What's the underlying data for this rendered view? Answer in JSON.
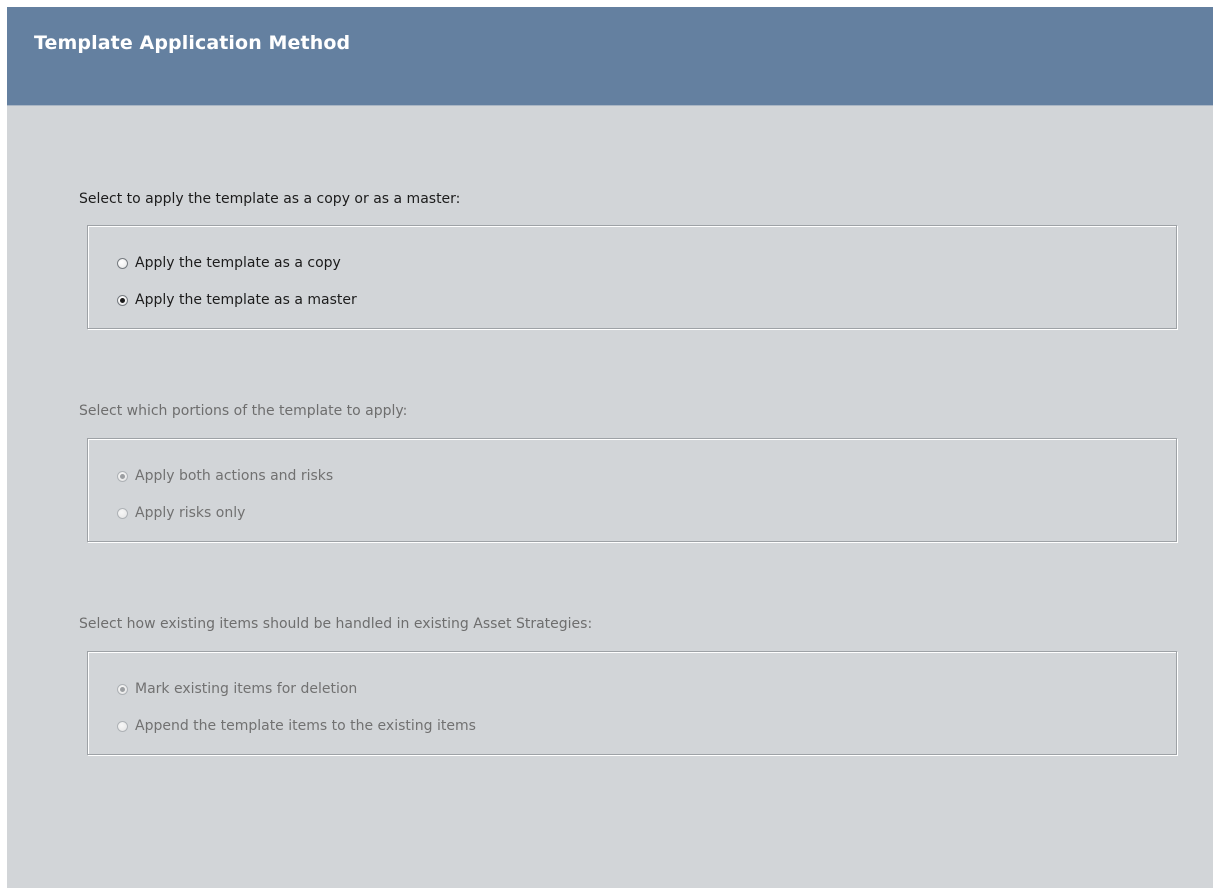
{
  "header": {
    "title": "Template Application Method"
  },
  "sections": [
    {
      "label": "Select to apply the template as a copy or as a master:",
      "enabled": true,
      "options": [
        {
          "label": "Apply the template as a copy",
          "selected": false
        },
        {
          "label": "Apply the template as a master",
          "selected": true
        }
      ]
    },
    {
      "label": "Select which portions of the template to apply:",
      "enabled": false,
      "options": [
        {
          "label": "Apply both actions and risks",
          "selected": true
        },
        {
          "label": "Apply risks only",
          "selected": false
        }
      ]
    },
    {
      "label": "Select how existing items should be handled in existing Asset Strategies:",
      "enabled": false,
      "options": [
        {
          "label": "Mark existing items for deletion",
          "selected": true
        },
        {
          "label": "Append the template items to the existing items",
          "selected": false
        }
      ]
    }
  ],
  "colors": {
    "header_background": "#6480a0",
    "panel_background": "#d2d5d8",
    "header_text": "#ffffff"
  }
}
